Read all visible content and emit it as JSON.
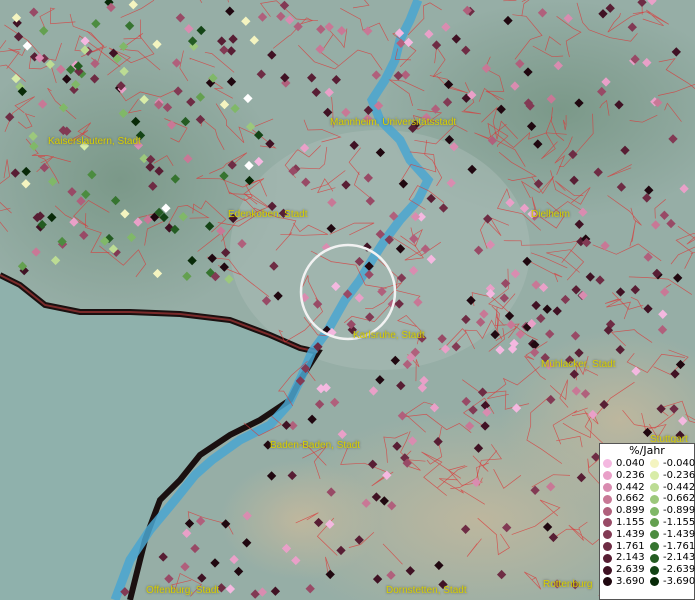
{
  "map": {
    "towns": [
      {
        "id": "kaiserslautern",
        "label": "Kaiserslautern, Stadt"
      },
      {
        "id": "mannheim",
        "label": "Mannheim, Universitätsstadt"
      },
      {
        "id": "edenkoben",
        "label": "Edenkoben, Stadt"
      },
      {
        "id": "dielheim",
        "label": "Dielheim"
      },
      {
        "id": "karlsruhe",
        "label": "Karlsruhe, Stadt"
      },
      {
        "id": "muehlacker",
        "label": "Mühlacker, Stadt"
      },
      {
        "id": "baden-baden",
        "label": "Baden-Baden, Stadt"
      },
      {
        "id": "stuttgart",
        "label": "Stuttgart"
      },
      {
        "id": "offenburg",
        "label": "Offenburg, Stadt"
      },
      {
        "id": "dornstetten",
        "label": "Dornstetten, Stadt"
      },
      {
        "id": "rottenburg",
        "label": "Rottenburg"
      }
    ]
  },
  "legend": {
    "title": "%/Jahr",
    "positive": [
      {
        "label": "0.040",
        "color": "#f4b8e0"
      },
      {
        "label": "0.236",
        "color": "#e9a0c8"
      },
      {
        "label": "0.442",
        "color": "#d98cb0"
      },
      {
        "label": "0.662",
        "color": "#c87896"
      },
      {
        "label": "0.899",
        "color": "#b0607c"
      },
      {
        "label": "1.155",
        "color": "#984a66"
      },
      {
        "label": "1.439",
        "color": "#823a54"
      },
      {
        "label": "1.761",
        "color": "#6e2c44"
      },
      {
        "label": "2.143",
        "color": "#581e34"
      },
      {
        "label": "2.639",
        "color": "#401224"
      },
      {
        "label": "3.690",
        "color": "#200810"
      }
    ],
    "negative": [
      {
        "label": "-0.040",
        "color": "#f4f4c0"
      },
      {
        "label": "-0.236",
        "color": "#d8eca8"
      },
      {
        "label": "-0.442",
        "color": "#bcdc94"
      },
      {
        "label": "-0.662",
        "color": "#9cc87c"
      },
      {
        "label": "-0.899",
        "color": "#80b868"
      },
      {
        "label": "-1.155",
        "color": "#64a050"
      },
      {
        "label": "-1.439",
        "color": "#4c8c40"
      },
      {
        "label": "-1.761",
        "color": "#367430"
      },
      {
        "label": "-2.143",
        "color": "#245c22"
      },
      {
        "label": "-2.639",
        "color": "#144416"
      },
      {
        "label": "-3.690",
        "color": "#082a08"
      }
    ]
  }
}
